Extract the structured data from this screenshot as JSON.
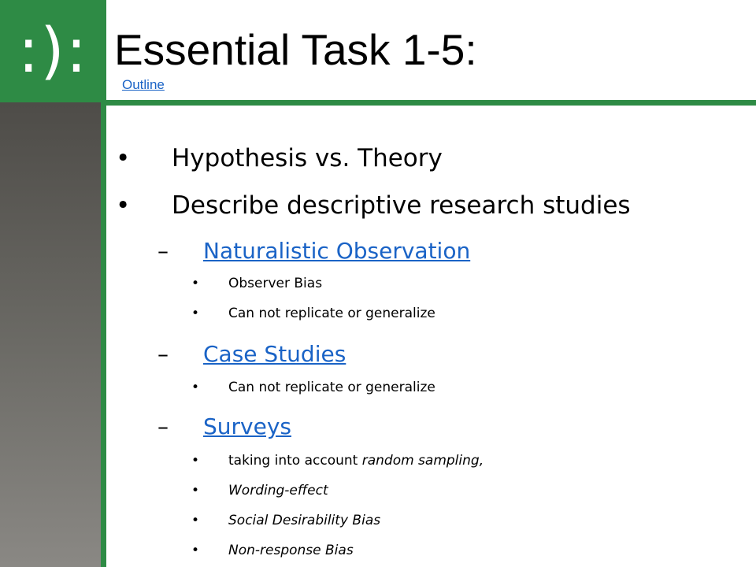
{
  "header": {
    "logo_text": ":):",
    "title": "Essential Task 1-5:",
    "outline_link": "Outline"
  },
  "bullets": [
    {
      "level": 1,
      "marker": "•",
      "text": "Hypothesis vs. Theory",
      "link": false
    },
    {
      "level": 1,
      "marker": "•",
      "text": "Describe descriptive research studies",
      "link": false
    },
    {
      "level": 2,
      "marker": "–",
      "text": "Naturalistic Observation",
      "link": true
    },
    {
      "level": 3,
      "marker": "•",
      "text": "Observer Bias",
      "link": false
    },
    {
      "level": 3,
      "marker": "•",
      "text": "Can not replicate or generalize",
      "link": false
    },
    {
      "level": 2,
      "marker": "–",
      "text": "Case Studies",
      "link": true
    },
    {
      "level": 3,
      "marker": "•",
      "text": "Can not replicate or generalize",
      "link": false
    },
    {
      "level": 2,
      "marker": "–",
      "text": "Surveys",
      "link": true
    },
    {
      "level": 3,
      "marker": "•",
      "text": "taking into account ",
      "italic_suffix": "random sampling,",
      "link": false
    },
    {
      "level": 3,
      "marker": "•",
      "text": "Wording-effect",
      "italic": true,
      "link": false
    },
    {
      "level": 3,
      "marker": "•",
      "text": "Social Desirability Bias",
      "italic": true,
      "link": false
    },
    {
      "level": 3,
      "marker": "•",
      "text": "Non-response Bias",
      "italic": true,
      "link": false
    }
  ],
  "colors": {
    "accent_green": "#2e8b45",
    "link_blue": "#1a63c6"
  }
}
